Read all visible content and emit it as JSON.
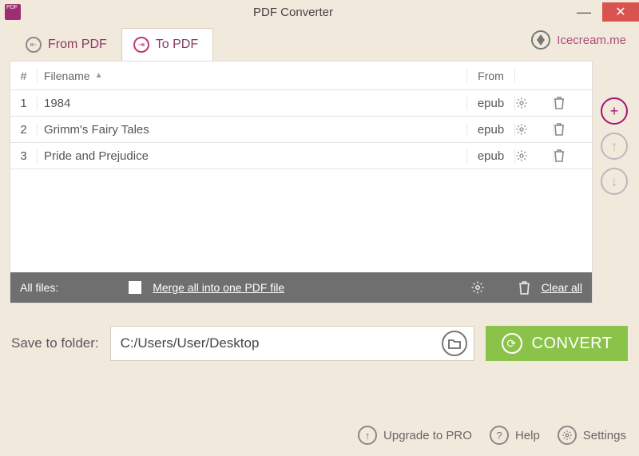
{
  "window": {
    "title": "PDF Converter"
  },
  "tabs": {
    "from_pdf": "From PDF",
    "to_pdf": "To PDF"
  },
  "brand": {
    "label": "Icecream.me"
  },
  "table": {
    "headers": {
      "index": "#",
      "filename": "Filename",
      "from": "From"
    },
    "rows": [
      {
        "idx": "1",
        "name": "1984",
        "from": "epub"
      },
      {
        "idx": "2",
        "name": "Grimm's Fairy Tales",
        "from": "epub"
      },
      {
        "idx": "3",
        "name": "Pride and Prejudice",
        "from": "epub"
      }
    ]
  },
  "footer": {
    "all_files": "All files:",
    "merge": "Merge all into one PDF file",
    "clear": "Clear all"
  },
  "save": {
    "label": "Save to folder:",
    "path": "C:/Users/User/Desktop",
    "convert": "CONVERT"
  },
  "bottom": {
    "upgrade": "Upgrade to PRO",
    "help": "Help",
    "settings": "Settings"
  }
}
